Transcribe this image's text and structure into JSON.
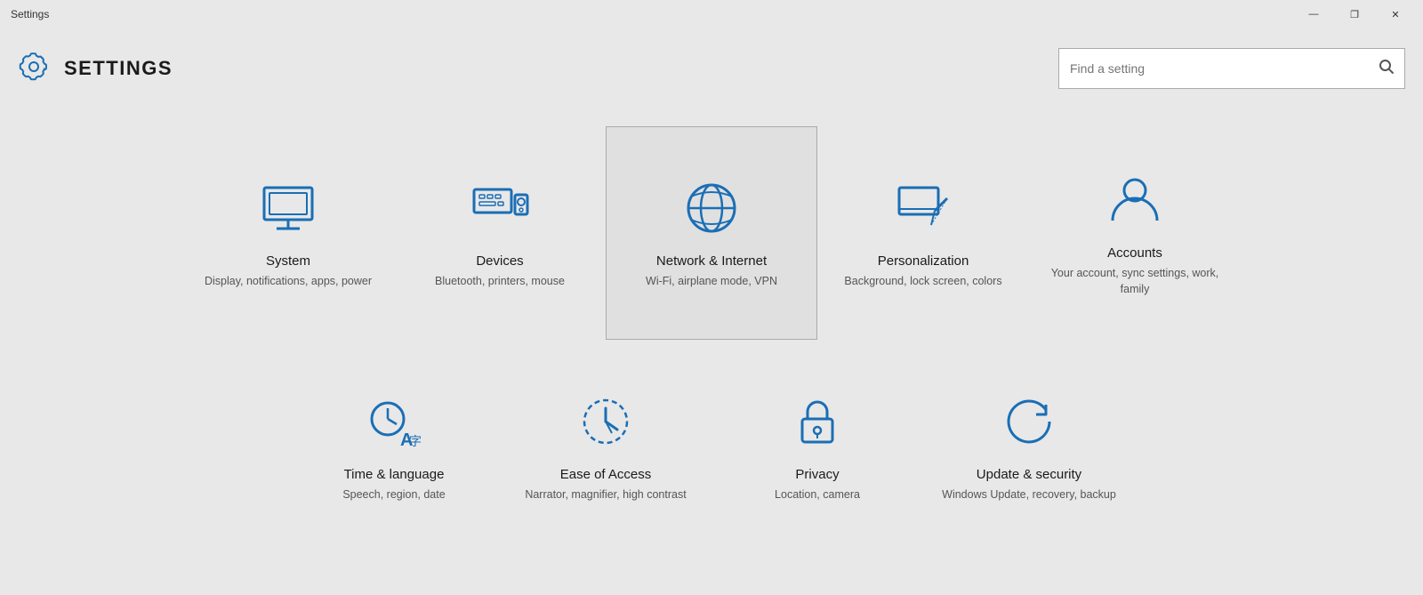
{
  "titleBar": {
    "title": "Settings",
    "minimize": "—",
    "maximize": "❐",
    "close": "✕"
  },
  "header": {
    "gearIcon": "gear-icon",
    "title": "SETTINGS",
    "search": {
      "placeholder": "Find a setting"
    }
  },
  "items": [
    {
      "id": "system",
      "title": "System",
      "desc": "Display, notifications, apps, power",
      "active": false
    },
    {
      "id": "devices",
      "title": "Devices",
      "desc": "Bluetooth, printers, mouse",
      "active": false
    },
    {
      "id": "network",
      "title": "Network & Internet",
      "desc": "Wi-Fi, airplane mode, VPN",
      "active": true
    },
    {
      "id": "personalization",
      "title": "Personalization",
      "desc": "Background, lock screen, colors",
      "active": false
    },
    {
      "id": "accounts",
      "title": "Accounts",
      "desc": "Your account, sync settings, work, family",
      "active": false
    }
  ],
  "items2": [
    {
      "id": "time",
      "title": "Time & language",
      "desc": "Speech, region, date",
      "active": false
    },
    {
      "id": "ease",
      "title": "Ease of Access",
      "desc": "Narrator, magnifier, high contrast",
      "active": false
    },
    {
      "id": "privacy",
      "title": "Privacy",
      "desc": "Location, camera",
      "active": false
    },
    {
      "id": "update",
      "title": "Update & security",
      "desc": "Windows Update, recovery, backup",
      "active": false
    }
  ]
}
